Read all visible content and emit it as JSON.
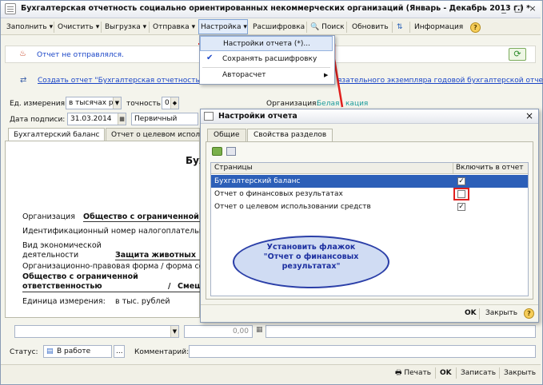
{
  "window": {
    "title": "Бухгалтерская отчетность социально ориентированных некоммерческих организаций (Январь - Декабрь 2013 г.) *",
    "minimize": "_",
    "maximize": "□",
    "close": "×"
  },
  "toolbar": {
    "fill": "Заполнить",
    "clear": "Очистить",
    "export": "Выгрузка",
    "send": "Отправка",
    "settings": "Настройка",
    "decoding": "Расшифровка",
    "search": "Поиск",
    "refresh": "Обновить",
    "info": "Информация",
    "help": "?"
  },
  "settings_menu": {
    "items": [
      {
        "label": "Настройки отчета (*)...",
        "checked": false
      },
      {
        "label": "Сохранять расшифровку",
        "checked": true
      },
      {
        "label": "Авторасчет",
        "submenu": true
      }
    ]
  },
  "info": {
    "status": "Отчет не отправлялся.",
    "create_link": "Создать отчет \"Бухгалтерская отчетность в Росс",
    "create_link_tail": "язательного экземпляра годовой бухгалтерской отче..."
  },
  "form": {
    "unit_label": "Ед. измерения:",
    "unit_value": "в тысячах р",
    "precision_label": "точность:",
    "precision_value": "0",
    "org_label": "Организация:",
    "org_value": "Белая",
    "org_tail": "кация",
    "date_label": "Дата подписи:",
    "date_value": "31.03.2014",
    "kind_value": "Первичный"
  },
  "doc_tabs": [
    "Бухгалтерский баланс",
    "Отчет о целевом использ"
  ],
  "doc": {
    "big_title": "Бух",
    "org_label": "Организация",
    "org_value": "Общество с ограниченной от",
    "inn_label": "Идентификационный номер налогоплательщ",
    "activity_label_1": "Вид экономической",
    "activity_label_2": "деятельности",
    "activity_value": "Защита животных",
    "legal_form_label": "Организационно-правовая форма / форма со",
    "legal_value_1": "Общество с ограниченной",
    "legal_value_2": "ответственностью",
    "legal_slash": "/",
    "legal_tail": "Смеш",
    "unit_label": "Единица измерения:",
    "unit_value": "в тыс. рублей"
  },
  "dialog": {
    "title": "Настройки отчета",
    "tabs": [
      "Общие",
      "Свойства разделов"
    ],
    "col_pages": "Страницы",
    "col_include": "Включить в отчет",
    "rows": [
      {
        "name": "Бухгалтерский баланс",
        "checked": true
      },
      {
        "name": "Отчет о финансовых результатах",
        "checked": false
      },
      {
        "name": "Отчет о целевом использовании средств",
        "checked": true
      }
    ],
    "callout": [
      "Установить флажок",
      "\"Отчет о финансовых",
      "результатах\""
    ],
    "ok": "OK",
    "close": "Закрыть",
    "help": "?"
  },
  "lower": {
    "amount": "0,00",
    "status_label": "Статус:",
    "status_value": "В работе",
    "status_more": "...",
    "comment_label": "Комментарий:"
  },
  "bottom": {
    "print": "Печать",
    "ok": "OK",
    "save": "Записать",
    "close": "Закрыть"
  },
  "colors": {
    "accent": "#2c5fb8",
    "link": "#1a45c7",
    "highlight_red": "#e0201e",
    "callout_fill": "#d0dcf3"
  }
}
